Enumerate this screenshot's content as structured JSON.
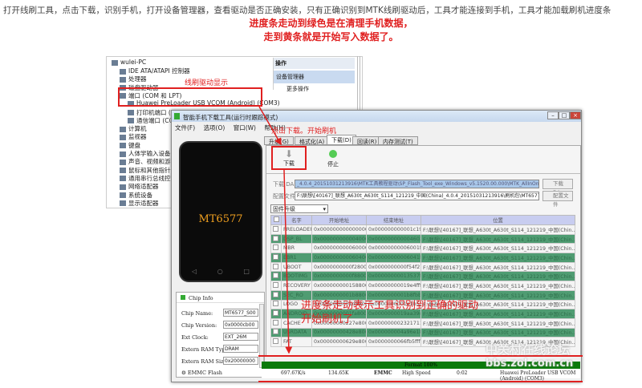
{
  "intro_text": "打开线刷工具，点击下载，识别手机，打开设备管理器，查看驱动是否正确安装，只有正确识别到MTK线刷驱动后，工具才能连接到手机，工具才能加载刷机进度条",
  "note_line1": "进度条走动到绿色是在清理手机数据，",
  "note_line2": "走到黄条就是开始写入数据了。",
  "device_manager": {
    "root": "wulei-PC",
    "items": [
      "IDE ATA/ATAPI 控制器",
      "处理器",
      "磁盘驱动器",
      "端口 (COM 和 LPT)",
      "Huawei PreLoader USB VCOM (Android) (COM3)",
      "打印机端口 (LPT1)",
      "通信端口 (COM1)",
      "计算机",
      "监视器",
      "键盘",
      "人体学输入设备",
      "声音、视频和游戏控制器",
      "鼠标和其他指针设备",
      "通用串行总线控制器",
      "网络适配器",
      "系统设备",
      "显示适配器"
    ],
    "actions_header": "操作",
    "actions_selected": "设备管理器",
    "actions_more": "更多操作"
  },
  "annotations": {
    "driver_shown": "线刷驱动显示",
    "click_download": "点击下载。开始刷机",
    "progress_note1": "进度条走动表示工具识别到正确的驱动",
    "progress_note2": "开始刷机了"
  },
  "tool": {
    "title": "智能手机下载工具(运行时跟踪模式)",
    "menu": [
      "文件(F)",
      "选项(O)",
      "窗口(W)",
      "帮助(H)"
    ],
    "phone_label": "MT6577",
    "chip_info_title": "Chip Info",
    "chip_info": [
      {
        "label": "Chip Name:",
        "value": "MT6577_S00"
      },
      {
        "label": "Chip Version:",
        "value": "0x0000cb00"
      },
      {
        "label": "Ext Clock:",
        "value": "EXT_26M"
      },
      {
        "label": "Extern RAM Type:",
        "value": "DRAM"
      },
      {
        "label": "Extern RAM Size:",
        "value": "0x20000000"
      }
    ],
    "emmc_flash": "EMMC Flash",
    "tabs": [
      "升级(G)",
      "格式化(A)",
      "下载(D)",
      "回读(R)",
      "内存测试(T)"
    ],
    "active_tab": "下载(D)",
    "download_btn": "下载",
    "stop_btn": "停止",
    "da_label": "下载 DA",
    "da_value": "_4.0.4_20151031213916\\MTK工具教程驱动\\SP_Flash_Tool_exe_Windows_v5.1520.00.000\\MTK_AllInOne_DA.bin",
    "da_button": "下载 DA",
    "config_label": "配置文件",
    "config_value": "F:\\联想\\[40167]_联想_A630t_A630t_S114_121219_中国(China)_4.0.4_20151031213916\\刷机包\\MT6577_Andr",
    "config_button": "配置文件",
    "mode_value": "固件升级",
    "columns": [
      "名字",
      "开始地址",
      "结束地址",
      "位置"
    ],
    "rows": [
      [
        "PRELOADER",
        "0x0000000000000000",
        "0x000000000001c193",
        "F:\\联想\\[40167]_联想_A630t_A630t_S114_121219_中国(Chin..."
      ],
      [
        "DSP_BL",
        "0x0000000000040000",
        "0x0000000000046023",
        "F:\\联想\\[40167]_联想_A630t_A630t_S114_121219_中国(Chin..."
      ],
      [
        "MBR",
        "0x0000000000600000",
        "0x00000000006001ff",
        "F:\\联想\\[40167]_联想_A630t_A630t_S114_121219_中国(Chin..."
      ],
      [
        "EBR1",
        "0x0000000000604000",
        "0x00000000006041ff",
        "F:\\联想\\[40167]_联想_A630t_A630t_S114_121219_中国(Chin..."
      ],
      [
        "UBOOT",
        "0x0000000000f28000",
        "0x0000000000f54f27",
        "F:\\联想\\[40167]_联想_A630t_A630t_S114_121219_中国(Chin..."
      ],
      [
        "BOOTIMG",
        "0x0000000000f88000",
        "0x00000000013537ff",
        "F:\\联想\\[40167]_联想_A630t_A630t_S114_121219_中国(Chin..."
      ],
      [
        "RECOVERY",
        "0x0000000001588000",
        "0x00000000019e4fff",
        "F:\\联想\\[40167]_联想_A630t_A630t_S114_121219_中国(Chin..."
      ],
      [
        "SEC_RO",
        "0x0000000001b88000",
        "0x0000000001b8fbb7",
        "F:\\联想\\[40167]_联想_A630t_A630t_S114_121219_中国(Chin..."
      ],
      [
        "LOGO",
        "0x0000000001d88000",
        "0x0000000001e1b527",
        "F:\\联想\\[40167]_联想_A630t_A630t_S114_121219_中国(Chin..."
      ],
      [
        "ANDROID",
        "0x0000000001fa8000",
        "0x0000000019aa39cf",
        "F:\\联想\\[40167]_联想_A630t_A630t_S114_121219_中国(Chin..."
      ],
      [
        "CACHE",
        "0x00000000227e8000",
        "0x0000000023217117",
        "F:\\联想\\[40167]_联想_A630t_A630t_S114_121219_中国(Chin..."
      ],
      [
        "USRDATA",
        "0x00000000428e8000",
        "0x000000004a96e18f",
        "F:\\联想\\[40167]_联想_A630t_A630t_S114_121219_中国(Chin..."
      ],
      [
        "FAT",
        "0x00000000629e8000",
        "0x0000000066fb5fff",
        "F:\\联想\\[40167]_联想_A630t_A630t_S114_121219_中国(Chin..."
      ]
    ],
    "progress_text": "Format 100%",
    "progress_percent": 100,
    "status": [
      "697.67K/s",
      "134.65K",
      "EMMC",
      "High Speed",
      "0:02",
      "Huawei PreLoader USB VCOM (Android) (COM3)"
    ]
  },
  "watermark": {
    "line1": "中关村在线论坛",
    "line2": "bbs.zol.com.cn"
  },
  "colors": {
    "annotation_red": "#e02020",
    "row_green": "#4f9c72",
    "progress_green": "#0a7a0a"
  }
}
